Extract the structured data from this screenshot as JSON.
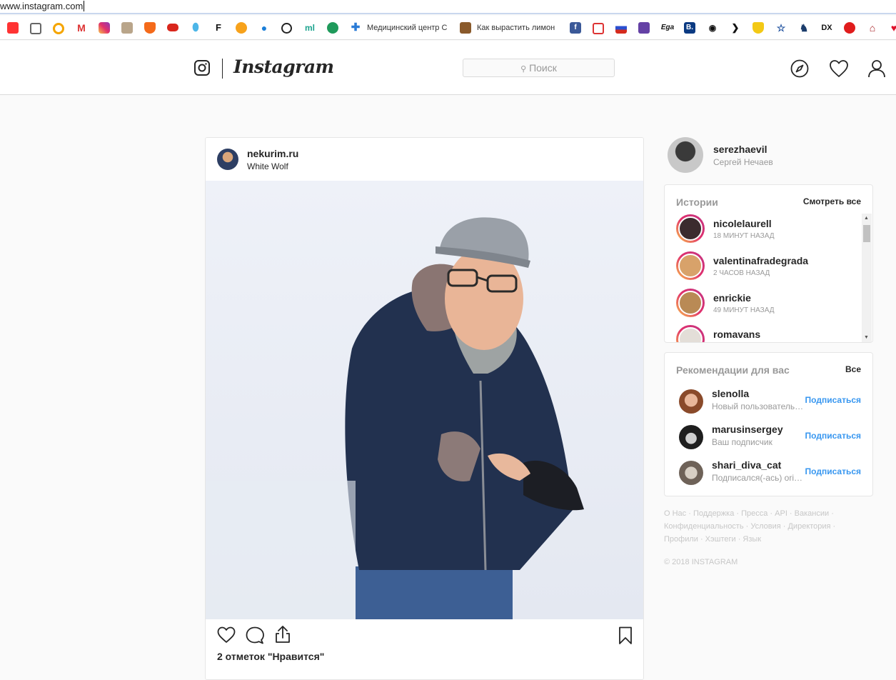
{
  "browser": {
    "url": "www.instagram.com",
    "bookmarks": {
      "b13": "Медицинский центр С",
      "b15": "Как вырастить лимон"
    },
    "bookmark_icons": {
      "b1": "mail-icon",
      "b2": "news-icon",
      "b3": "q-icon",
      "b4": "gmail-icon",
      "b5": "instagram-icon",
      "b6": "game-icon",
      "b7": "shield-icon",
      "b8": "glasses-icon",
      "b9": "map-pin-icon",
      "b10": "f-icon",
      "b11": "film-icon",
      "b12": "drop-icon",
      "b16": "facebook-icon",
      "b17": "chat-icon",
      "b18": "flag-ru-icon",
      "b19": "twitch-icon",
      "b20": "booking-icon",
      "b21": "tripadvisor-icon",
      "b22": "star-icon",
      "b23": "dx-icon",
      "b24": "block-icon",
      "b25": "house-icon"
    },
    "bookmark_glyphs": {
      "f": "F",
      "ega": "Ega",
      "booking": "B.",
      "dx": "DX"
    }
  },
  "header": {
    "brand": "Instagram",
    "search_placeholder": "Поиск"
  },
  "post": {
    "username": "nekurim.ru",
    "location": "White Wolf",
    "likes": "2 отметок \"Нравится\""
  },
  "profile": {
    "username": "serezhaevil",
    "full_name": "Сергей Нечаев"
  },
  "stories": {
    "title": "Истории",
    "see_all": "Смотреть все",
    "items": [
      {
        "name": "nicolelaurell",
        "time": "18 МИНУТ НАЗАД"
      },
      {
        "name": "valentinafradegrada",
        "time": "2 ЧАСОВ НАЗАД"
      },
      {
        "name": "enrickie",
        "time": "49 МИНУТ НАЗАД"
      },
      {
        "name": "romavans",
        "time": ""
      }
    ]
  },
  "suggestions": {
    "title": "Рекомендации для вас",
    "see_all": "Все",
    "follow_label": "Подписаться",
    "items": [
      {
        "name": "slenolla",
        "sub": "Новый пользователь Instagram"
      },
      {
        "name": "marusinsergey",
        "sub": "Ваш подписчик"
      },
      {
        "name": "shari_diva_cat",
        "sub": "Подписался(-ась) oricat"
      }
    ]
  },
  "footer": {
    "links": "О Нас · Поддержка · Пресса · API · Вакансии · Конфиденциальность · Условия · Директория · Профили · Хэштеги · Язык",
    "copyright": "© 2018 INSTAGRAM"
  },
  "colors": {
    "accent": "#3897f0",
    "story_ring": "#e1306c",
    "muted": "#999999"
  }
}
